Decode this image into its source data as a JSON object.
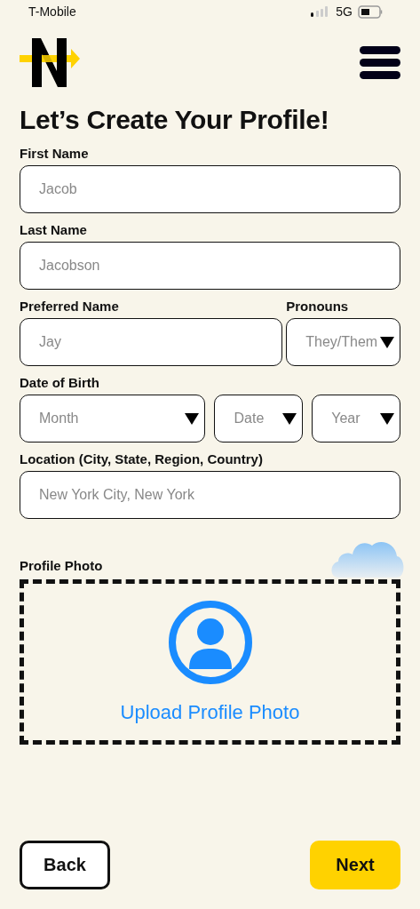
{
  "status_bar": {
    "carrier": "T-Mobile",
    "network": "5G"
  },
  "title": "Let’s Create Your Profile!",
  "rows": [
    {
      "fields": [
        {
          "label": "First Name",
          "kind": "input",
          "placeholder": "Jacob"
        }
      ]
    },
    {
      "fields": [
        {
          "label": "Last Name",
          "kind": "input",
          "placeholder": "Jacobson"
        }
      ]
    },
    {
      "fields": [
        {
          "label": "Preferred Name",
          "kind": "input",
          "placeholder": "Jay"
        },
        {
          "label": "Pronouns",
          "kind": "select",
          "placeholder": "They/Them"
        }
      ]
    },
    {
      "fields": [
        {
          "label": "Date of Birth",
          "kind": "select",
          "placeholder": "Month"
        },
        {
          "kind": "select",
          "placeholder": "Date"
        },
        {
          "kind": "select",
          "placeholder": "Year"
        }
      ]
    },
    {
      "fields": [
        {
          "label": "Location (City, State, Region, Country)",
          "kind": "input",
          "placeholder": "New York City, New York"
        }
      ]
    }
  ],
  "photo": {
    "label": "Profile Photo",
    "upload": "Upload Profile Photo"
  },
  "buttons": [
    {
      "label": "Back",
      "kind": "secondary"
    },
    {
      "label": "Next",
      "kind": "primary"
    }
  ]
}
